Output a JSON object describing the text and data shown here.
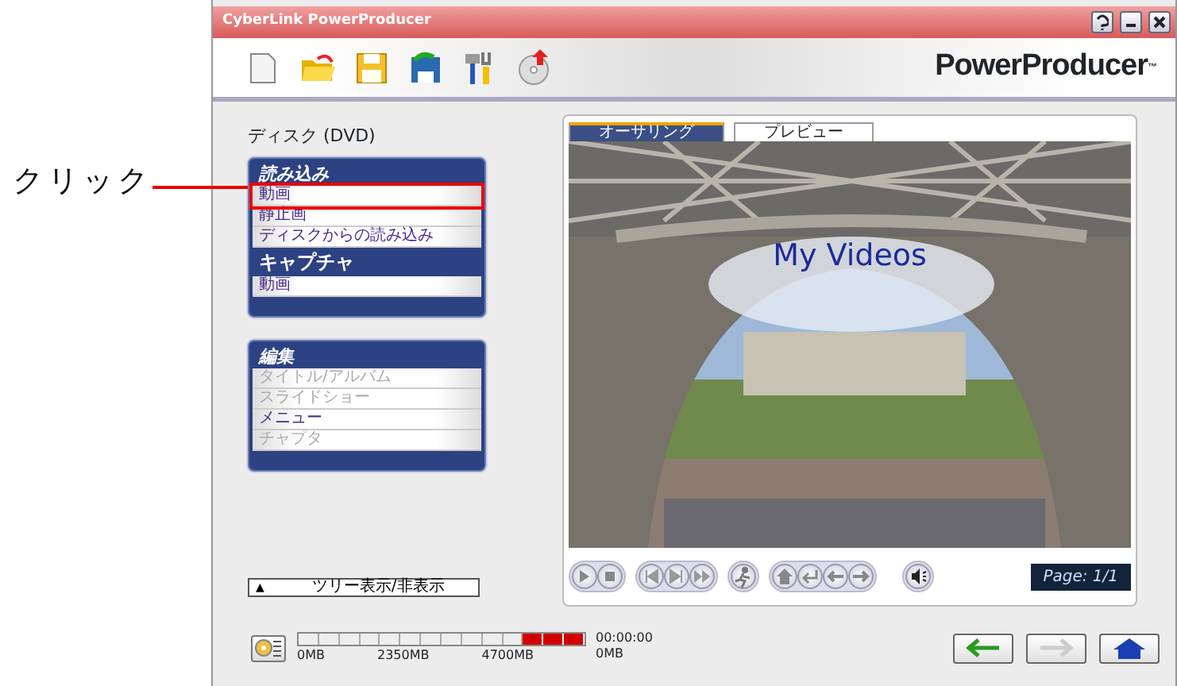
{
  "annotation": {
    "label": "クリック"
  },
  "window": {
    "title": "CyberLink PowerProducer",
    "brand": "PowerProducer",
    "brand_mark": "™"
  },
  "toolbar": [
    {
      "kind": "new"
    },
    {
      "kind": "open"
    },
    {
      "kind": "save"
    },
    {
      "kind": "saveas"
    },
    {
      "kind": "tools"
    },
    {
      "kind": "burn"
    }
  ],
  "disc_label": "ディスク (DVD)",
  "panels": [
    {
      "sections": [
        {
          "title": "読み込み",
          "italic": true,
          "items": [
            {
              "label": "動画",
              "disabled": false,
              "highlighted": true
            },
            {
              "label": "静止画",
              "disabled": false,
              "highlighted": false
            },
            {
              "label": "ディスクからの読み込み",
              "disabled": false,
              "highlighted": false
            }
          ]
        },
        {
          "title": "キャプチャ",
          "italic": false,
          "items": [
            {
              "label": "動画",
              "disabled": false,
              "highlighted": false
            }
          ]
        }
      ]
    },
    {
      "sections": [
        {
          "title": "編集",
          "italic": true,
          "items": [
            {
              "label": "タイトル/アルバム",
              "disabled": true,
              "highlighted": false
            },
            {
              "label": "スライドショー",
              "disabled": true,
              "highlighted": false
            },
            {
              "label": "メニュー",
              "disabled": false,
              "highlighted": false
            },
            {
              "label": "チャプタ",
              "disabled": true,
              "highlighted": false
            }
          ]
        }
      ]
    }
  ],
  "tree_toggle": {
    "arrow": "▲",
    "label": "ツリー表示/非表示"
  },
  "tabs": [
    {
      "label": "オーサリング",
      "selected": true
    },
    {
      "label": "プレビュー",
      "selected": false
    }
  ],
  "preview": {
    "kind": "picture",
    "title": "My Videos"
  },
  "player_groups": [
    {
      "buttons": [
        {
          "kind": "play"
        },
        {
          "kind": "stop"
        }
      ]
    },
    {
      "buttons": [
        {
          "kind": "prev"
        },
        {
          "kind": "next"
        },
        {
          "kind": "skip"
        }
      ]
    },
    {
      "buttons": [
        {
          "kind": "menu"
        }
      ]
    },
    {
      "buttons": [
        {
          "kind": "home"
        },
        {
          "kind": "enter"
        },
        {
          "kind": "left"
        },
        {
          "kind": "right"
        }
      ]
    },
    {
      "buttons": [
        {
          "kind": "volume"
        }
      ]
    }
  ],
  "page_indicator": "Page: 1/1",
  "disc_gauge": {
    "ticks": [
      "0MB",
      "2350MB",
      "4700MB"
    ],
    "time": "00:00:00",
    "size": "0MB"
  },
  "nav": [
    {
      "kind": "back",
      "disabled": false
    },
    {
      "kind": "forward",
      "disabled": true
    },
    {
      "kind": "home",
      "disabled": false
    }
  ]
}
